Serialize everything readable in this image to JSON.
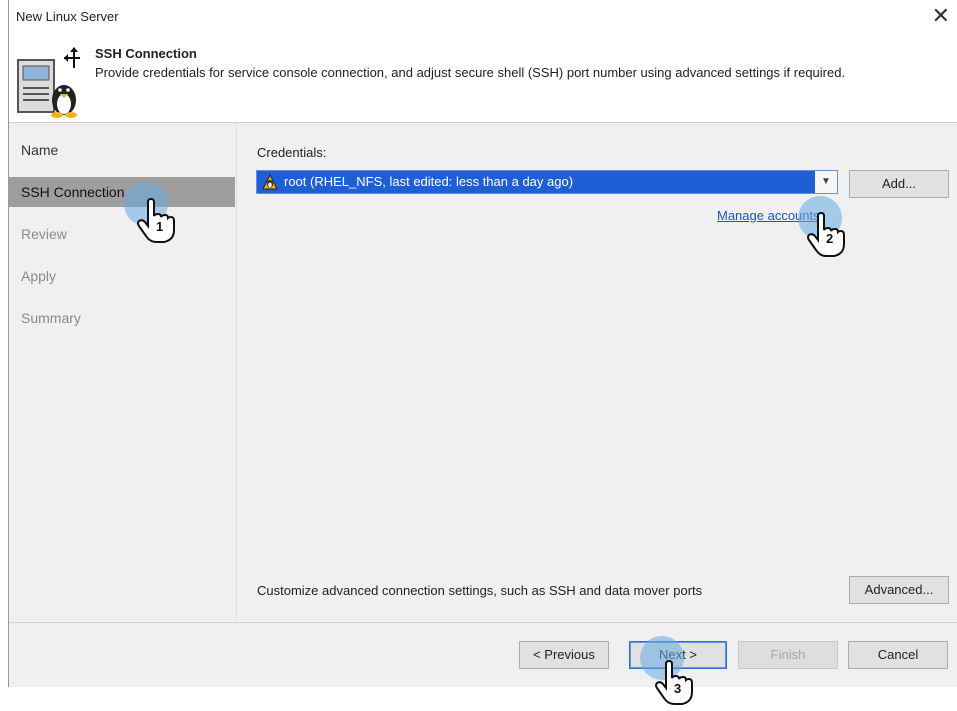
{
  "window": {
    "title": "New Linux Server",
    "close_symbol": "✕"
  },
  "header": {
    "title": "SSH Connection",
    "description": "Provide credentials for service console connection, and adjust secure shell (SSH) port number using advanced settings if required."
  },
  "sidebar": {
    "steps": [
      {
        "label": "Name",
        "state": "done"
      },
      {
        "label": "SSH Connection",
        "state": "active"
      },
      {
        "label": "Review",
        "state": "pending"
      },
      {
        "label": "Apply",
        "state": "pending"
      },
      {
        "label": "Summary",
        "state": "pending"
      }
    ]
  },
  "content": {
    "credentials_label": "Credentials:",
    "credentials_value": "root (RHEL_NFS, last edited: less than a day ago)",
    "add_button": "Add...",
    "manage_accounts_link": "Manage accounts",
    "advanced_text": "Customize advanced connection settings, such as SSH and data mover ports",
    "advanced_button": "Advanced..."
  },
  "footer": {
    "previous_button": "< Previous",
    "next_button": "Next >",
    "finish_button": "Finish",
    "cancel_button": "Cancel"
  },
  "annotations": [
    {
      "number": "1",
      "target": "SSH Connection"
    },
    {
      "number": "2",
      "target": "Manage accounts"
    },
    {
      "number": "3",
      "target": "Next >"
    }
  ],
  "colors": {
    "selection_blue": "#1f5fd6",
    "active_step": "#9e9e9e",
    "link": "#1a55cc",
    "click_marker": "#68aae1"
  }
}
